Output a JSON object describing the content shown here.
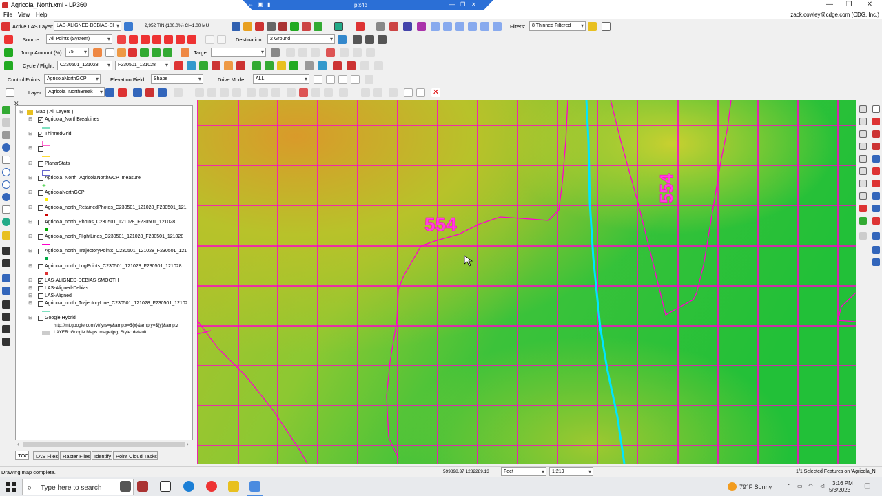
{
  "window": {
    "title": "Agricola_North.xml - LP360",
    "remote_label": "pix4d",
    "user": "zack.cowley@cdge.com (CDG, Inc.)"
  },
  "menu": [
    "File",
    "View",
    "Help"
  ],
  "toolbar1": {
    "active_las_label": "Active LAS Layer:",
    "active_las_value": "LAS-ALIGNED-DEBIAS-SI",
    "tin_info": "2,952 TIN (100.0%) CI=1.00 MU",
    "filters_label": "Filters:",
    "filters_value": "8 Thinned Filtered"
  },
  "toolbar2": {
    "source_label": "Source:",
    "source_value": "All Points (System)",
    "destination_label": "Destination:",
    "destination_value": "2 Ground"
  },
  "toolbar3": {
    "jump_label": "Jump Amount (%):",
    "jump_value": "75",
    "target_label": "Target:",
    "target_value": ""
  },
  "toolbar4": {
    "cycle_label": "Cycle / Flight:",
    "cycle_value1": "C230501_121028",
    "cycle_value2": "F230501_121028"
  },
  "toolbar5": {
    "control_label": "Control Points:",
    "control_value": "AgricolaNorthGCP",
    "elev_label": "Elevation Field:",
    "elev_value": "Shape",
    "drive_label": "Drive Mode:",
    "drive_value": "ALL"
  },
  "toolbar6": {
    "layer_label": "Layer:",
    "layer_value": "Agricola_NorthBreak"
  },
  "toc": {
    "root": "Map ( All Layers )",
    "layers": [
      {
        "name": "Agricola_NorthBreaklines",
        "checked": true
      },
      {
        "name": "ThinnedGrid",
        "checked": true
      },
      {
        "name": "",
        "checked": false
      },
      {
        "name": "PlanarStats",
        "checked": false
      },
      {
        "name": "Agricola_North_AgricolaNorthGCP_measure",
        "checked": false
      },
      {
        "name": "AgricolaNorthGCP",
        "checked": false
      },
      {
        "name": "Agricola_north_RetainedPhotos_C230501_121028_F230501_121",
        "checked": false
      },
      {
        "name": "Agricola_north_Photos_C230501_121028_F230501_121028",
        "checked": false
      },
      {
        "name": "Agricola_north_FlightLines_C230501_121028_F230501_121028",
        "checked": false
      },
      {
        "name": "Agricola_north_TrajectoryPoints_C230501_121028_F230501_121",
        "checked": false
      },
      {
        "name": "Agricola_north_LogPoints_C230501_121028_F230501_121028",
        "checked": false
      },
      {
        "name": "LAS-ALIGNED-DEBIAS-SMOOTH",
        "checked": true
      },
      {
        "name": "LAS-Aligned-Debias",
        "checked": false
      },
      {
        "name": "LAS-Aligned",
        "checked": false
      },
      {
        "name": "Agricola_north_TrajectoryLine_C230501_121028_F230501_12102",
        "checked": false
      },
      {
        "name": "Google Hybrid",
        "checked": false
      }
    ],
    "google_url": "http://mt.google.com/vt/lyrs=y&amp;x=${x}&amp;y=${y}&amp;z",
    "google_layer": "LAYER: Google Maps image/jpg, Style: default",
    "tabs": [
      "TOC",
      "LAS Files",
      "Raster Files",
      "Identify",
      "Point Cloud Tasks"
    ]
  },
  "map": {
    "label_a": "554",
    "label_b": "554",
    "grid_color": "#ff00cc",
    "contour_color": "#ff00cc",
    "stream_color": "#00e5ff"
  },
  "status": {
    "message": "Drawing map complete.",
    "coords": "599898.37 1282289.13",
    "units": "Feet",
    "scale": "1:219",
    "selected": "1/1 Selected Features on 'Agricola_N"
  },
  "taskbar": {
    "search_placeholder": "Type here to search",
    "weather": "79°F  Sunny",
    "time": "3:16 PM",
    "date": "5/3/2023"
  }
}
